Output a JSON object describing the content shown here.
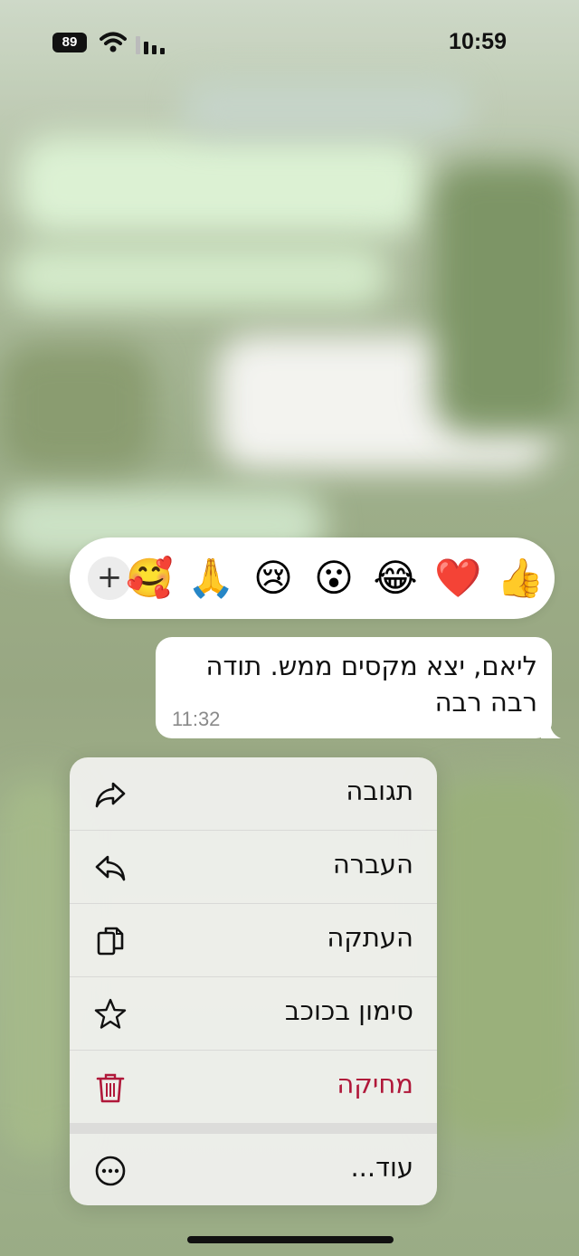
{
  "status_bar": {
    "time": "10:59",
    "battery": "89"
  },
  "reactions": {
    "emojis": [
      "👍",
      "❤️",
      "😂",
      "😮",
      "😢",
      "🙏",
      "🥰"
    ],
    "more_label": "+"
  },
  "message": {
    "text": "ליאם, יצא מקסים ממש. תודה רבה רבה",
    "time": "11:32"
  },
  "context_menu": {
    "items": [
      {
        "label": "תגובה",
        "icon": "reply-icon"
      },
      {
        "label": "העברה",
        "icon": "forward-icon"
      },
      {
        "label": "העתקה",
        "icon": "copy-icon"
      },
      {
        "label": "סימון בכוכב",
        "icon": "star-icon"
      },
      {
        "label": "מחיקה",
        "icon": "trash-icon",
        "color": "#b0183a"
      },
      {
        "label": "עוד...",
        "icon": "more-icon"
      }
    ]
  }
}
